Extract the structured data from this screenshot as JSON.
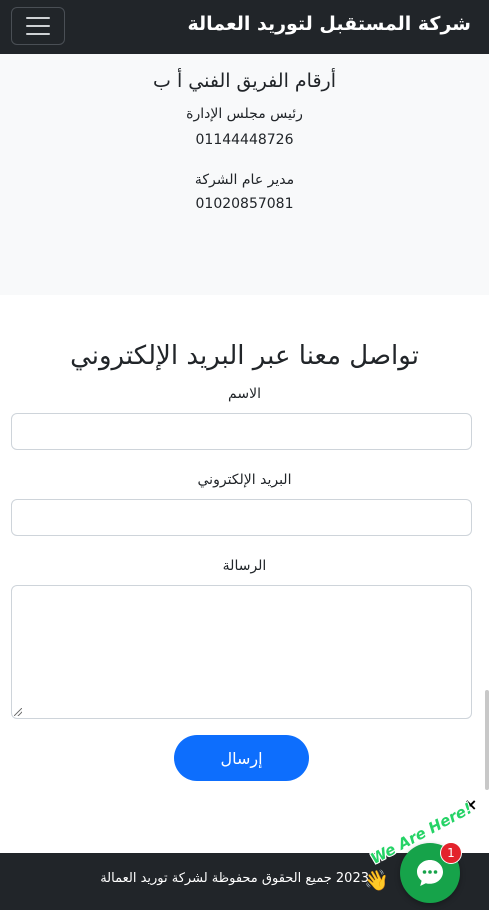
{
  "navbar": {
    "brand": "شركة المستقبل لتوريد العمالة",
    "toggler_icon": "hamburger-menu-icon"
  },
  "phones": {
    "title": "أرقام الفريق الفني أ ب",
    "contacts": [
      {
        "role": "رئيس مجلس الإدارة",
        "number": "01144448726"
      },
      {
        "role": "مدير عام الشركة",
        "number": "01020857081"
      }
    ]
  },
  "contact_form": {
    "title": "تواصل معنا عبر البريد الإلكتروني",
    "name_label": "الاسم",
    "name_value": "",
    "email_label": "البريد الإلكتروني",
    "email_value": "",
    "message_label": "الرسالة",
    "message_value": "",
    "submit_label": "إرسال"
  },
  "footer": {
    "text": "2023 جميع الحقوق محفوظة لشركة توريد العمالة"
  },
  "chat_widget": {
    "close_glyph": "×",
    "tagline": "We Are Here!",
    "hand_icon": "waving-hand-icon",
    "chat_icon": "chat-bubble-icon",
    "unread_count": "1",
    "accent_color": "#16a34a",
    "badge_color": "#e3232c"
  },
  "colors": {
    "navbar_bg": "#212529",
    "primary_button": "#0d6efd",
    "section_bg": "#f8f9fa"
  }
}
